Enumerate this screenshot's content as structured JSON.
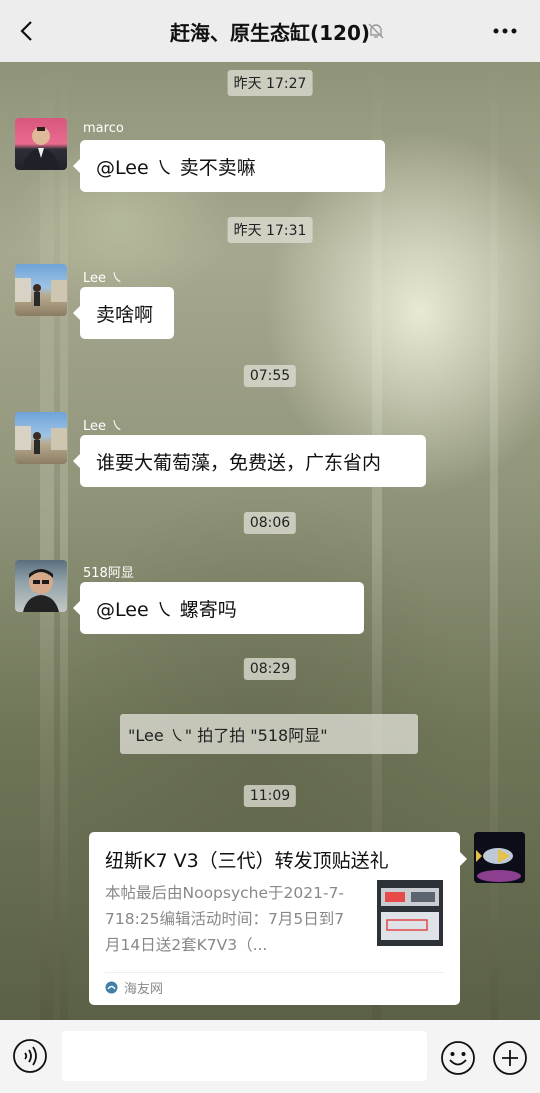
{
  "header": {
    "title": "赶海、原生态缸(120)",
    "back_icon": "chevron-left-icon",
    "mute_icon": "bell-off-icon",
    "more_icon": "more-icon"
  },
  "messages": {
    "t1": "昨天 17:27",
    "m1_sender": "marco",
    "m1_text": "@Lee                     ㇏ 卖不卖嘛",
    "t2": "昨天 17:31",
    "m2_sender": "Lee                      ㇏",
    "m2_text": "卖啥啊",
    "t3": "07:55",
    "m3_sender": "Lee                      ㇏",
    "m3_text": "谁要大葡萄藻，免费送，广东省内",
    "t4": "08:06",
    "m4_sender": "518阿显",
    "m4_text": "@Lee                    ㇏ 螺寄吗",
    "t5": "08:29",
    "pat_text": "\"Lee                   ㇏\" 拍了拍 \"518阿显\"",
    "t6": "11:09",
    "card_title": "纽斯K7 V3（三代）转发顶贴送礼",
    "card_desc": "本帖最后由Noopsyche于2021-7-718:25编辑活动时间：7月5日到7月14日送2套K7V3（...",
    "card_source": "海友网"
  },
  "footer": {
    "voice_icon": "voice-icon",
    "emoji_icon": "emoji-icon",
    "plus_icon": "plus-icon"
  }
}
